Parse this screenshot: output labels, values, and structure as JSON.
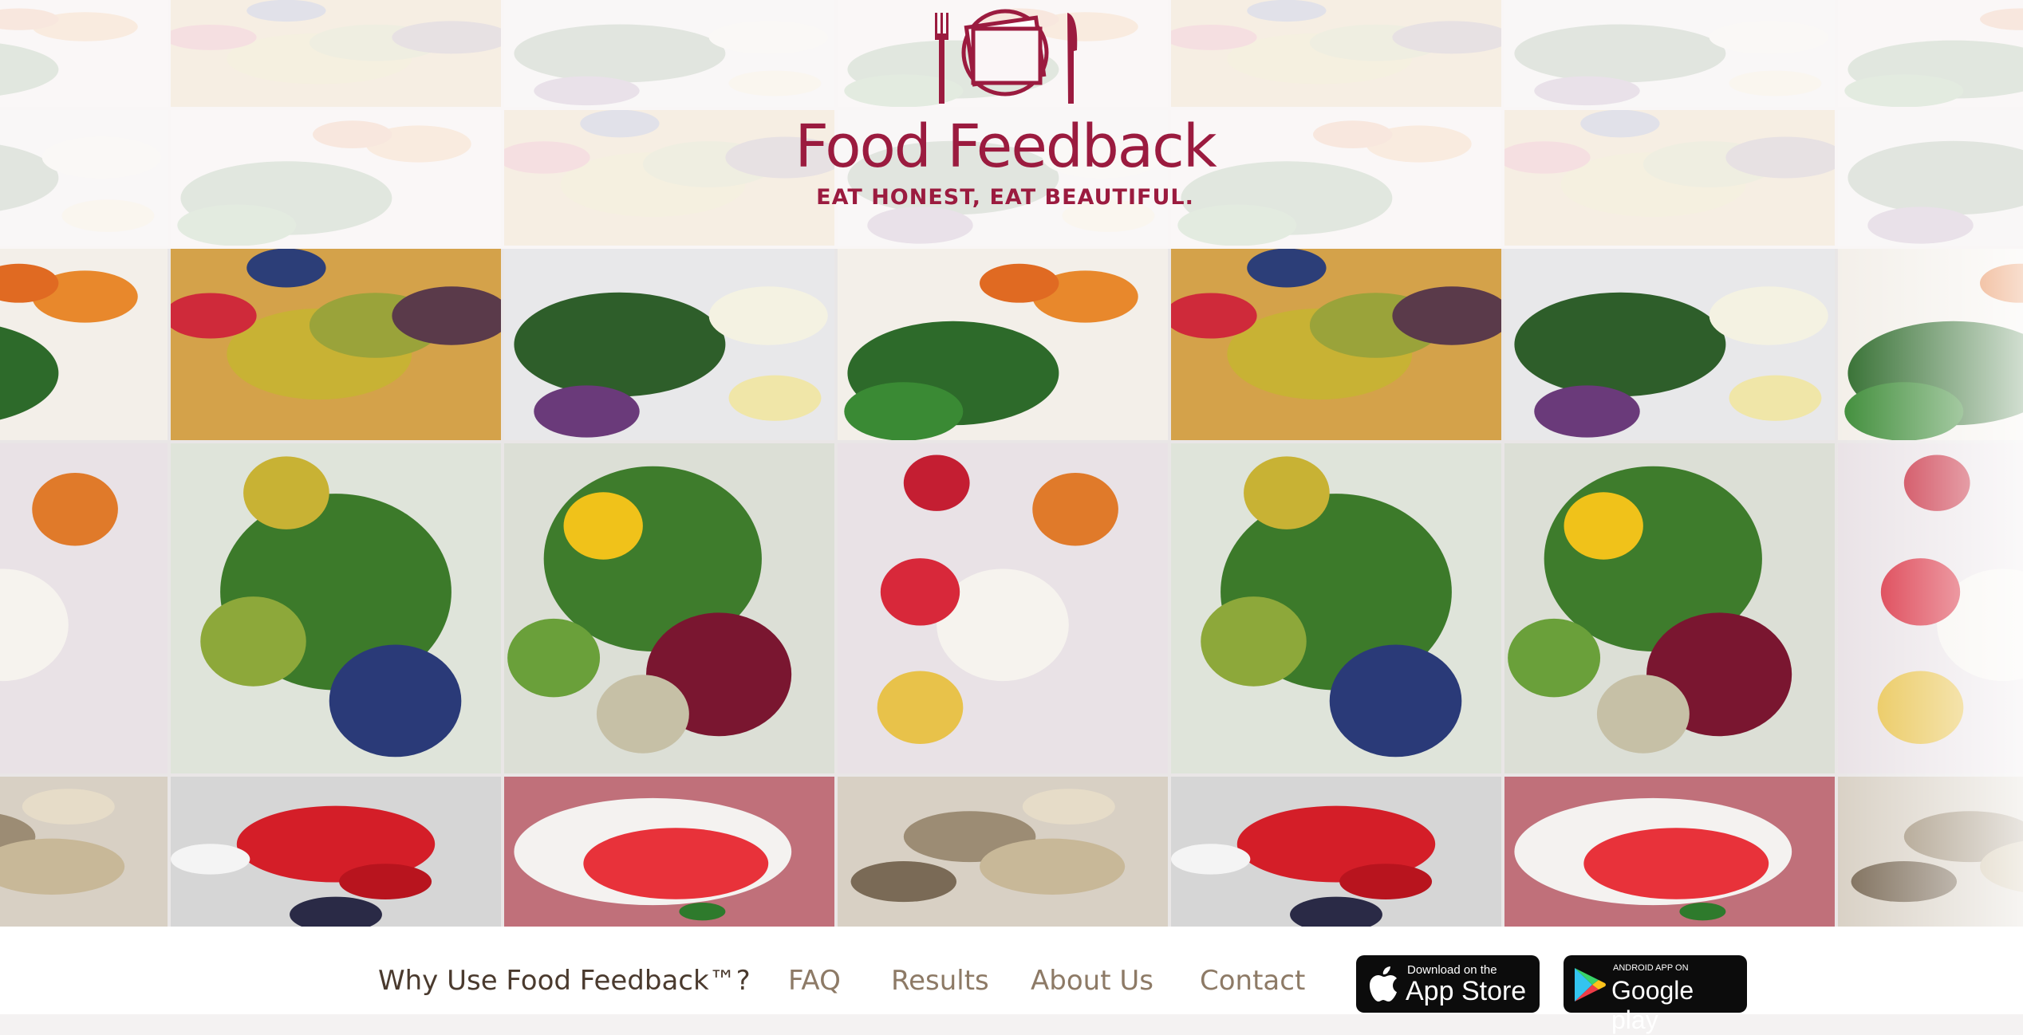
{
  "brand": {
    "name": "Food Feedback",
    "tagline": "EAT HONEST, EAT BEAUTIFUL.",
    "color": "#9b1b3f"
  },
  "nav": {
    "why": "Why Use Food Feedback™?",
    "faq": "FAQ",
    "results": "Results",
    "about": "About Us",
    "contact": "Contact"
  },
  "badges": {
    "appstore": {
      "small": "Download on the",
      "big": "App Store",
      "icon": "apple-icon"
    },
    "googleplay": {
      "small": "ANDROID APP ON",
      "big": "Google play",
      "icon": "google-play-icon"
    }
  },
  "photos": [
    "salad-with-oranges",
    "fruit-platter-avocado-figs",
    "greens-with-cheese",
    "fruit-ricotta-plate",
    "mixed-salad-blueberries",
    "salad-mango-berries",
    "strawberries",
    "watermelon-bowl",
    "roasted-pumpkin-seeds"
  ]
}
